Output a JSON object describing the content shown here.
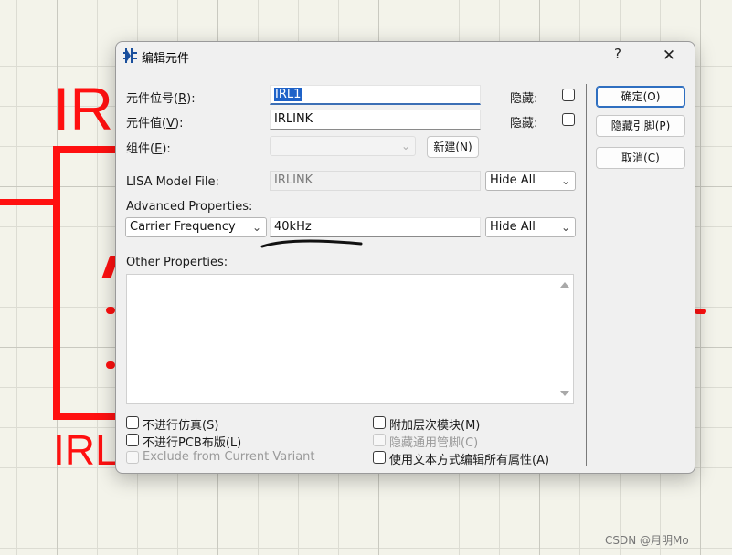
{
  "background": {
    "component_ref_text": "IR",
    "component_value_text": "IRL",
    "schematic_color": "#ff1010"
  },
  "dialog": {
    "title": "编辑元件",
    "title_icon": "component-edit-icon",
    "help_label": "?",
    "close_label": "✕",
    "fields": {
      "designator": {
        "label": "元件位号",
        "hotkey": "R",
        "value": "IRL1",
        "hidden_label": "隐藏:"
      },
      "value": {
        "label": "元件值",
        "hotkey": "V",
        "value": "IRLINK",
        "hidden_label": "隐藏:"
      },
      "group": {
        "label": "组件",
        "hotkey": "E",
        "value": "",
        "new_button": "新建(N)"
      },
      "lisa_model": {
        "label": "LISA Model File:",
        "value": "IRLINK",
        "visibility": "Hide All"
      }
    },
    "advanced": {
      "label": "Advanced Properties:",
      "property": "Carrier Frequency",
      "value": "40kHz",
      "visibility": "Hide All"
    },
    "other": {
      "label_pre": "Other ",
      "label_hot": "P",
      "label_post": "roperties:",
      "text": ""
    },
    "options": {
      "left": [
        {
          "label": "不进行仿真(S)",
          "checked": false,
          "enabled": true
        },
        {
          "label": "不进行PCB布版(L)",
          "checked": false,
          "enabled": true
        },
        {
          "label": "Exclude from Current Variant",
          "checked": false,
          "enabled": false
        }
      ],
      "right": [
        {
          "label": "附加层次模块(M)",
          "checked": false,
          "enabled": true
        },
        {
          "label": "隐藏通用管脚(C)",
          "checked": false,
          "enabled": false
        },
        {
          "label": "使用文本方式编辑所有属性(A)",
          "checked": false,
          "enabled": true
        }
      ]
    },
    "buttons": {
      "ok": "确定(O)",
      "hide_pins": "隐藏引脚(P)",
      "cancel": "取消(C)"
    },
    "accent_color": "#2f6fc0"
  },
  "annotation": {
    "color": "#111111",
    "description": "hand-drawn underline"
  },
  "watermark": "CSDN @月明Mo"
}
